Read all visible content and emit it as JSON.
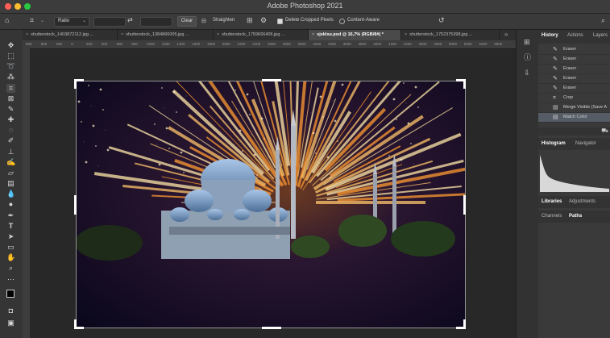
{
  "app": {
    "title": "Adobe Photoshop 2021",
    "traffic_lights": [
      "#fe5f57",
      "#febc2e",
      "#28c840"
    ]
  },
  "options_bar": {
    "ratio_label": "Ratio",
    "clear_label": "Clear",
    "straighten_label": "Straighten",
    "delete_cropped_label": "Delete Cropped Pixels",
    "content_aware_label": "Content-Aware"
  },
  "document_tabs": [
    "shutterstock_1403872112.jpg ...",
    "shutterstock_1384866005.jpg ...",
    "shutterstock_1759666406.jpg ...",
    "sjsklsu.psd @ 16,7% (RGB/8#) *",
    "shutterstock_1752375398.jpg ..."
  ],
  "ruler": {
    "ticks": [
      "800",
      "600",
      "200",
      "0",
      "200",
      "400",
      "600",
      "800",
      "1000",
      "1200",
      "1400",
      "1600",
      "1800",
      "2000",
      "2200",
      "2400",
      "2600",
      "2800",
      "3000",
      "3200",
      "3400",
      "3600",
      "3800",
      "4000",
      "4200",
      "4400",
      "4600",
      "4800",
      "5000",
      "5200",
      "5400",
      "5600"
    ]
  },
  "panels": {
    "tabs_top": [
      "History",
      "Actions",
      "Layers"
    ],
    "history": [
      {
        "icon": "brush-icon",
        "label": "Eraser"
      },
      {
        "icon": "brush-icon",
        "label": "Eraser"
      },
      {
        "icon": "brush-icon",
        "label": "Eraser"
      },
      {
        "icon": "brush-icon",
        "label": "Eraser"
      },
      {
        "icon": "brush-icon",
        "label": "Eraser"
      },
      {
        "icon": "crop-icon",
        "label": "Crop"
      },
      {
        "icon": "doc-icon",
        "label": "Merge Visible (Save A"
      },
      {
        "icon": "doc-icon",
        "label": "Match Color"
      }
    ],
    "histogram_tabs": [
      "Histogram",
      "Navigator"
    ],
    "libraries_tabs": [
      "Libraries",
      "Adjustments"
    ],
    "channels_tabs": [
      "Channels",
      "Paths"
    ]
  },
  "colors": {
    "accent_selected": "#555c66",
    "panel_bg": "#3a3a3a"
  }
}
